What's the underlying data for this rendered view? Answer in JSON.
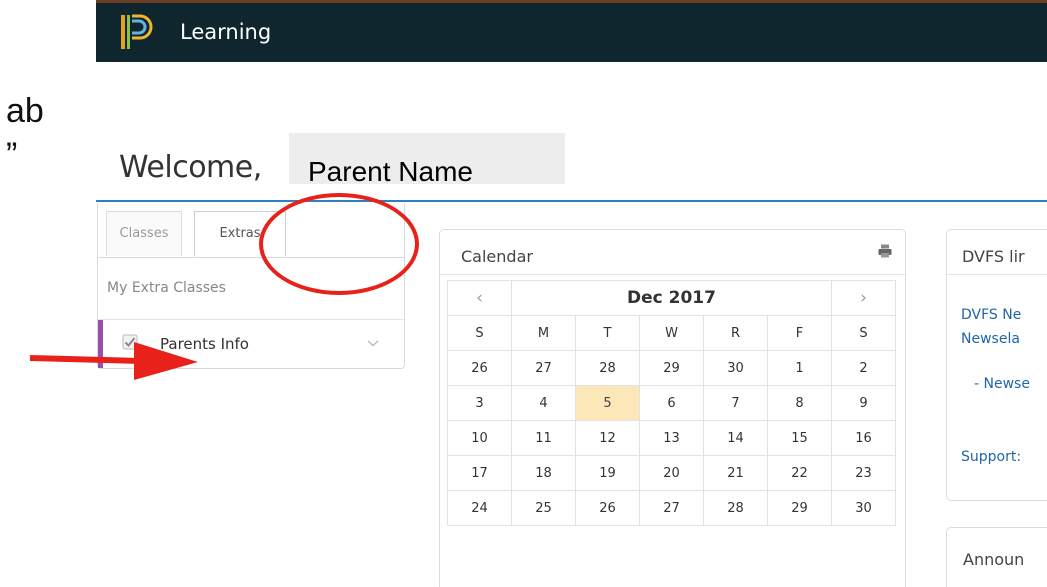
{
  "annotation": {
    "line1": "ab",
    "line2": "”"
  },
  "topbar": {
    "brand": "Learning",
    "bg_color": "#10262e"
  },
  "welcome": {
    "greeting": "Welcome,",
    "name": "Parent Name"
  },
  "sidebar": {
    "tabs": [
      {
        "label": "Classes",
        "active": false
      },
      {
        "label": "Extras",
        "active": true
      }
    ],
    "section_label": "My Extra Classes",
    "items": [
      {
        "label": "Parents Info",
        "icon": "checkbox-icon",
        "accent_color": "#9a4fb0"
      }
    ]
  },
  "calendar": {
    "title": "Calendar",
    "month": "Dec 2017",
    "prev": "‹",
    "next": "›",
    "weekdays": [
      "S",
      "M",
      "T",
      "W",
      "R",
      "F",
      "S"
    ],
    "weeks": [
      [
        "26",
        "27",
        "28",
        "29",
        "30",
        "1",
        "2"
      ],
      [
        "3",
        "4",
        "5",
        "6",
        "7",
        "8",
        "9"
      ],
      [
        "10",
        "11",
        "12",
        "13",
        "14",
        "15",
        "16"
      ],
      [
        "17",
        "18",
        "19",
        "20",
        "21",
        "22",
        "23"
      ],
      [
        "24",
        "25",
        "26",
        "27",
        "28",
        "29",
        "30"
      ]
    ],
    "today": "5",
    "today_color": "#fbe7b8"
  },
  "dvfs": {
    "title": "DVFS lir",
    "links": [
      "DVFS Ne",
      "Newsela",
      "- Newse",
      "Support:"
    ]
  },
  "announcements": {
    "title": "Announ"
  },
  "highlight": {
    "circle_color": "#e8211b",
    "arrow_color": "#e8211b"
  }
}
